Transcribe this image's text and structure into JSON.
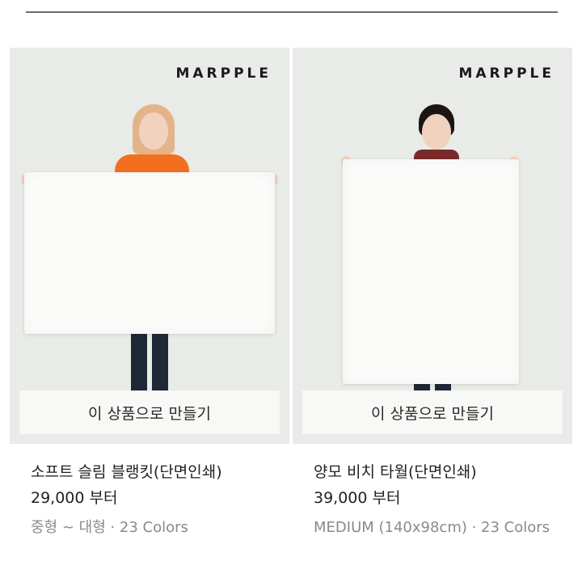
{
  "products": [
    {
      "brand": "MARPPLE",
      "make_label": "이 상품으로 만들기",
      "title": "소프트 슬림 블랭킷(단면인쇄)",
      "price": "29,000 부터",
      "meta": "중형 ~ 대형 · 23 Colors",
      "colors": {
        "shirt": "#f26f1f",
        "hair": "#e3b487"
      }
    },
    {
      "brand": "MARPPLE",
      "make_label": "이 상품으로 만들기",
      "title": "양모 비치 타월(단면인쇄)",
      "price": "39,000 부터",
      "meta": "MEDIUM (140x98cm) · 23 Colors",
      "colors": {
        "shirt": "#7a2a2a",
        "hair": "#1c1512"
      }
    }
  ]
}
